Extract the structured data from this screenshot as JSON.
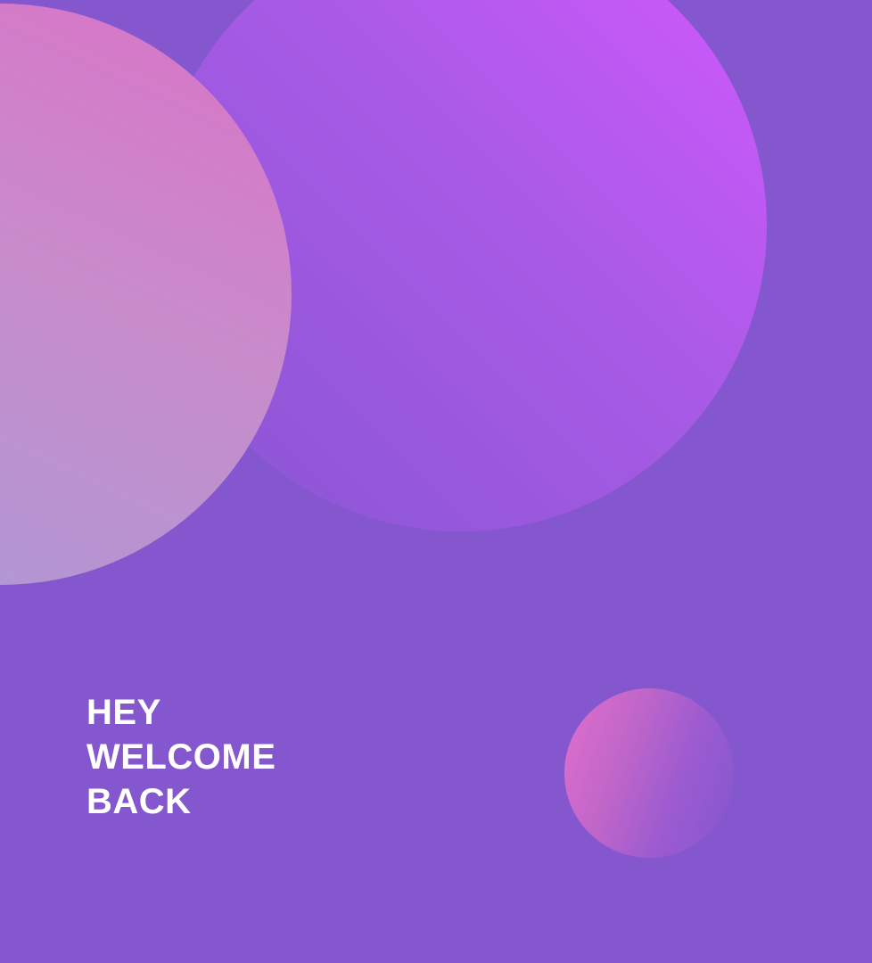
{
  "welcome": {
    "lines": [
      "HEY",
      "WELCOME",
      "BACK"
    ]
  },
  "colors": {
    "background": "#8457ce",
    "text": "#ffffff",
    "large_circle": [
      "#d458ff",
      "#8756d2"
    ],
    "left_circle": [
      "#da72c7",
      "#a99ad6"
    ],
    "small_circle": [
      "#e16fcc",
      "#8457ce"
    ]
  }
}
